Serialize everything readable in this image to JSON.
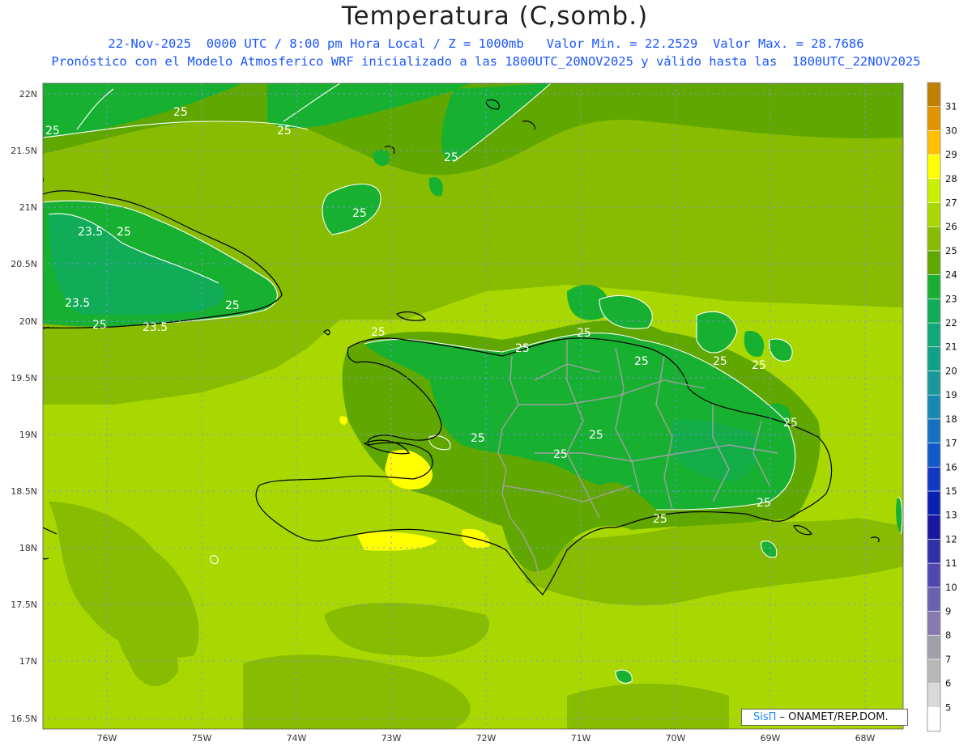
{
  "title": "Temperatura (C,somb.)",
  "subtitle_line1": "22-Nov-2025  0000 UTC / 8:00 pm Hora Local / Z = 1000mb   Valor Min. = 22.2529  Valor Max. = 28.7686",
  "subtitle_line2": "Pronóstico con el Modelo Atmosferico WRF inicializado a las 1800UTC_20NOV2025 y válido hasta las  1800UTC_22NOV2025",
  "credit": {
    "brand": "SisΠ",
    "rest": " – ONAMET/REP.DOM."
  },
  "lat_labels": [
    "22N",
    "21.5N",
    "21N",
    "20.5N",
    "20N",
    "19.5N",
    "19N",
    "18.5N",
    "18N",
    "17.5N",
    "17N",
    "16.5N"
  ],
  "lon_labels": [
    "76W",
    "75W",
    "74W",
    "73W",
    "72W",
    "71W",
    "70W",
    "69W",
    "68W"
  ],
  "colorbar": {
    "levels": [
      "5",
      "6",
      "7",
      "8",
      "9",
      "10",
      "11",
      "12",
      "13",
      "15",
      "16",
      "17",
      "18",
      "19",
      "20",
      "21",
      "22",
      "23",
      "24",
      "25",
      "26",
      "27",
      "28",
      "29",
      "30",
      "31"
    ],
    "colors": [
      "#ffffff",
      "#d9d9d9",
      "#b8b8b8",
      "#a0a0a8",
      "#8878b0",
      "#6a62b0",
      "#5048b0",
      "#3030a8",
      "#1818a0",
      "#0a20b0",
      "#1038c0",
      "#1258c8",
      "#1470c0",
      "#1888b0",
      "#18989a",
      "#10a088",
      "#10a878",
      "#10ac58",
      "#18b030",
      "#60a800",
      "#88bc00",
      "#a8d800",
      "#c8f000",
      "#ffff00",
      "#ffc000",
      "#e09400",
      "#c08000"
    ]
  },
  "contour_labels": [
    "25",
    "25",
    "25",
    "25",
    "25",
    "23.5",
    "25",
    "23.5",
    "25",
    "25",
    "23.5",
    "25",
    "25",
    "25",
    "25",
    "25",
    "25",
    "25",
    "25",
    "25",
    "25",
    "25",
    "25"
  ],
  "colors": {
    "title": "#202020",
    "subtitle": "#1a55ff",
    "coast": "#000000",
    "borders": "#a0a0a0",
    "contour": "#ffffff"
  }
}
